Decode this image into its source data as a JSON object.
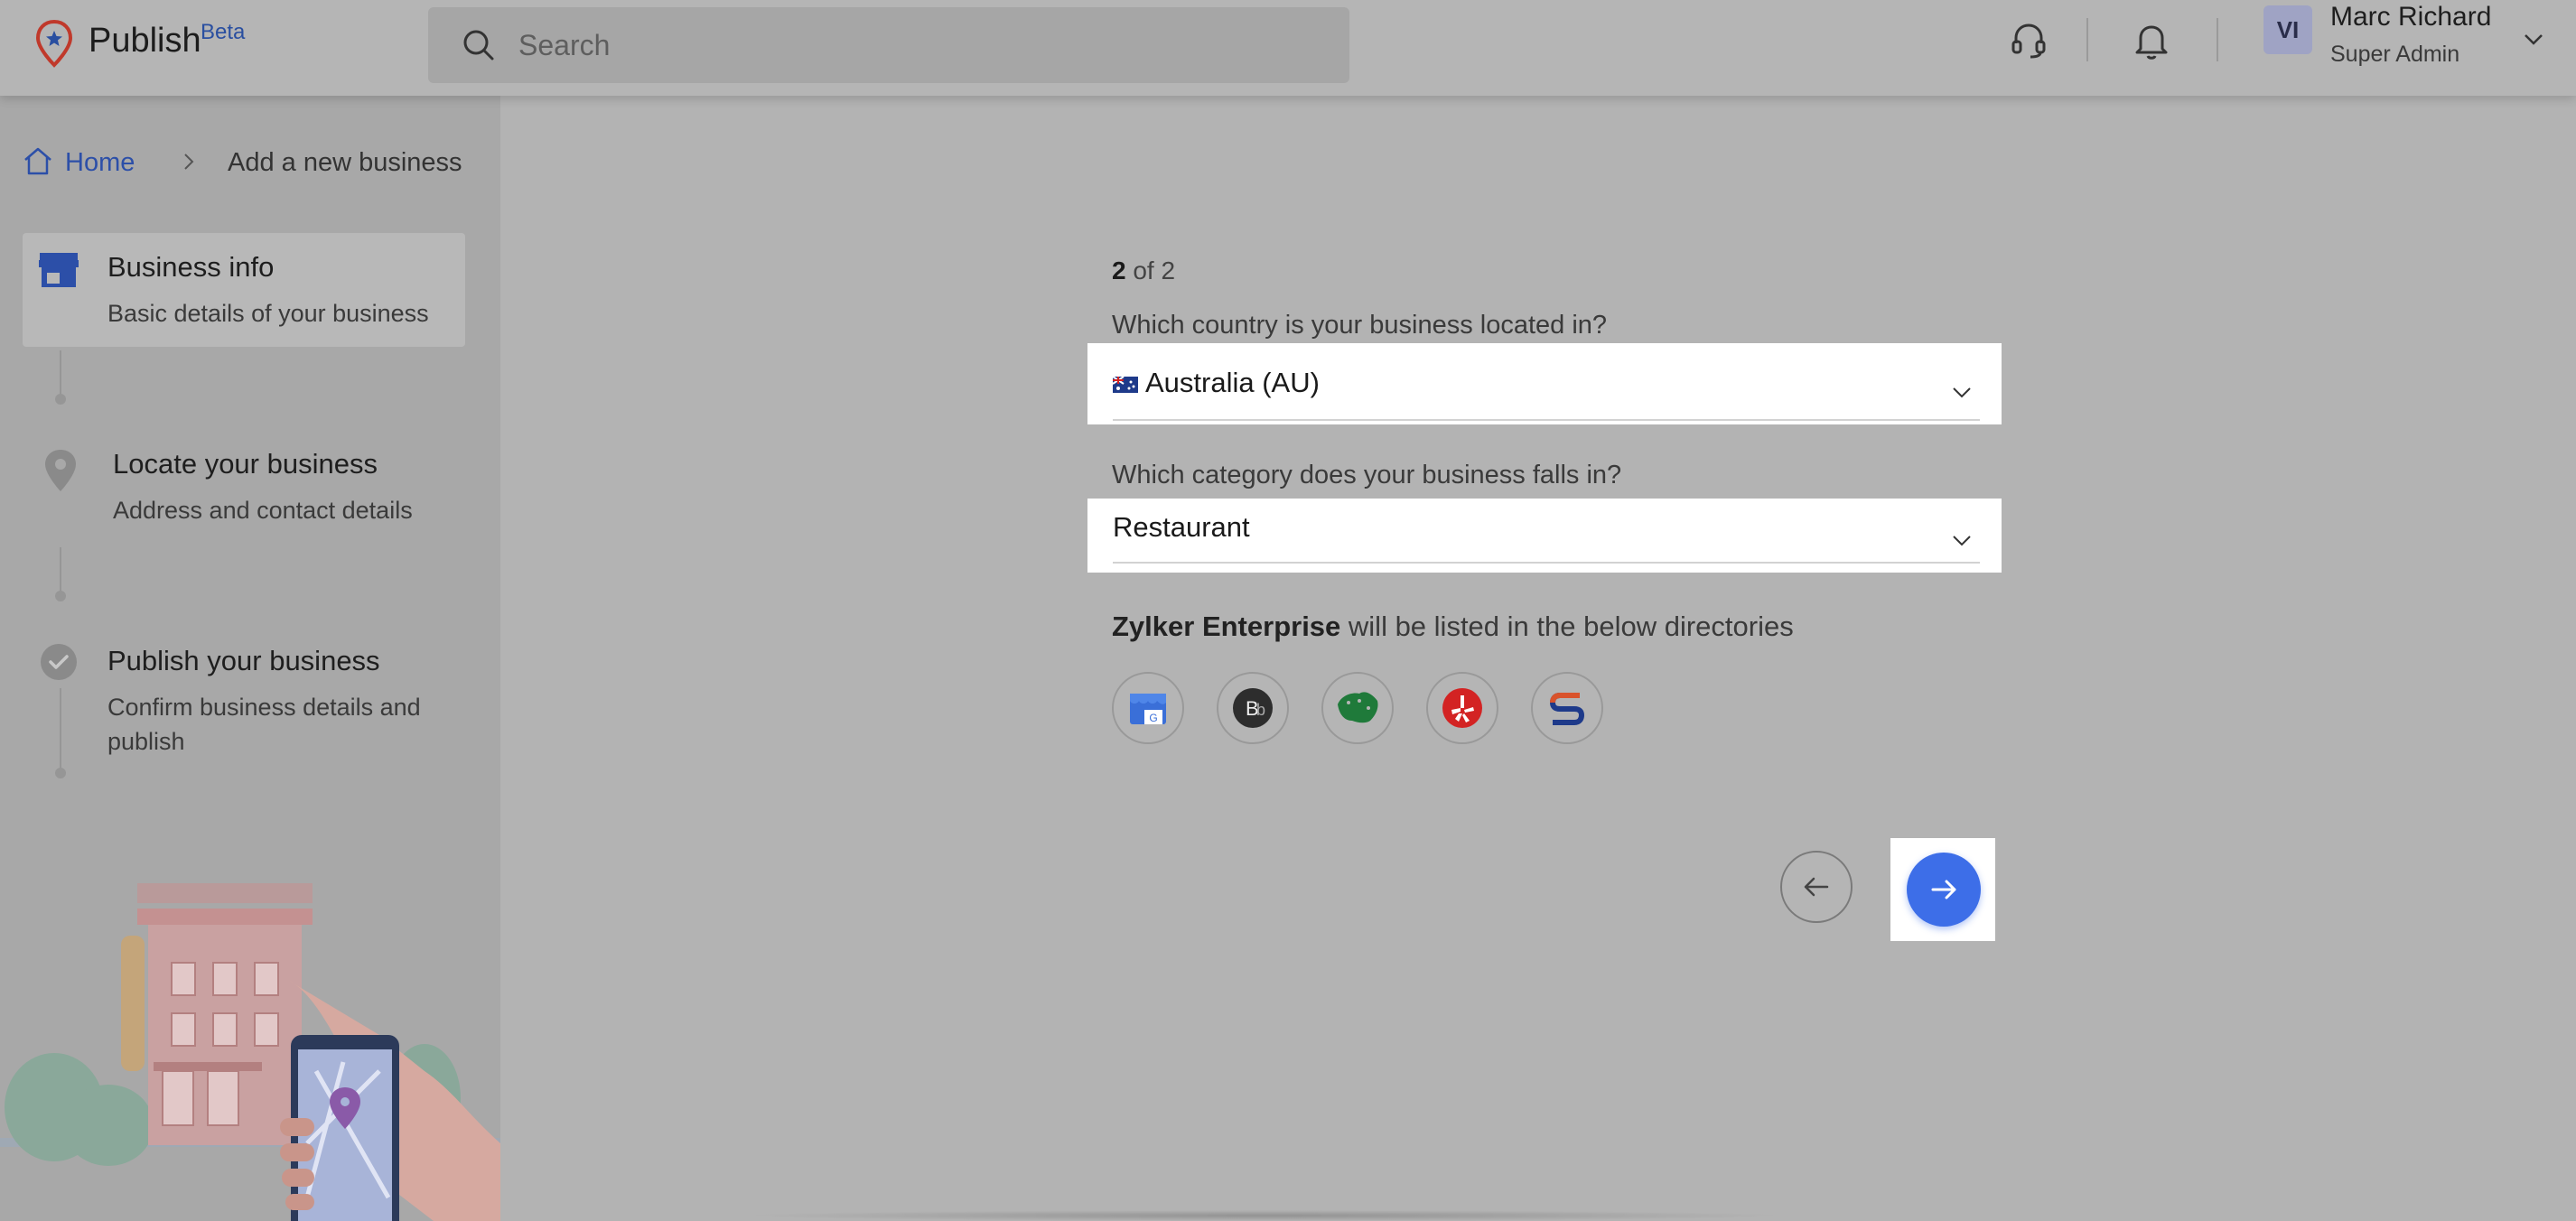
{
  "header": {
    "app_name": "Publish",
    "app_badge": "Beta",
    "search_placeholder": "Search",
    "support_icon": "headset-icon",
    "notification_icon": "bell-icon",
    "user": {
      "initials": "VI",
      "name": "Marc Richard",
      "role": "Super Admin"
    }
  },
  "breadcrumb": {
    "home": "Home",
    "current": "Add a new business"
  },
  "steps": [
    {
      "title": "Business info",
      "desc": "Basic details of your business",
      "icon": "store-icon",
      "active": true
    },
    {
      "title": "Locate your business",
      "desc": "Address and contact details",
      "icon": "location-pin-icon",
      "active": false
    },
    {
      "title": "Publish your business",
      "desc": "Confirm business details and publish",
      "icon": "check-circle-icon",
      "active": false
    }
  ],
  "form": {
    "step_current": "2",
    "step_total": " of 2",
    "country_label": "Which country is your business located in?",
    "country_value": "Australia (AU)",
    "category_label": "Which category does your business falls in?",
    "category_value": "Restaurant",
    "listing_business": "Zylker Enterprise",
    "listing_suffix": " will be listed in the below directories",
    "directories": [
      {
        "name": "google-business-icon",
        "color": "#3a6fd8"
      },
      {
        "name": "brownbook-icon",
        "color": "#2d2d2d"
      },
      {
        "name": "australia-directory-icon",
        "color": "#1f7a3a"
      },
      {
        "name": "yelp-icon",
        "color": "#d32323"
      },
      {
        "name": "s-directory-icon",
        "color": "#1e3a8a"
      }
    ]
  },
  "colors": {
    "accent": "#3d6ee8",
    "link": "#2c4fa8"
  }
}
